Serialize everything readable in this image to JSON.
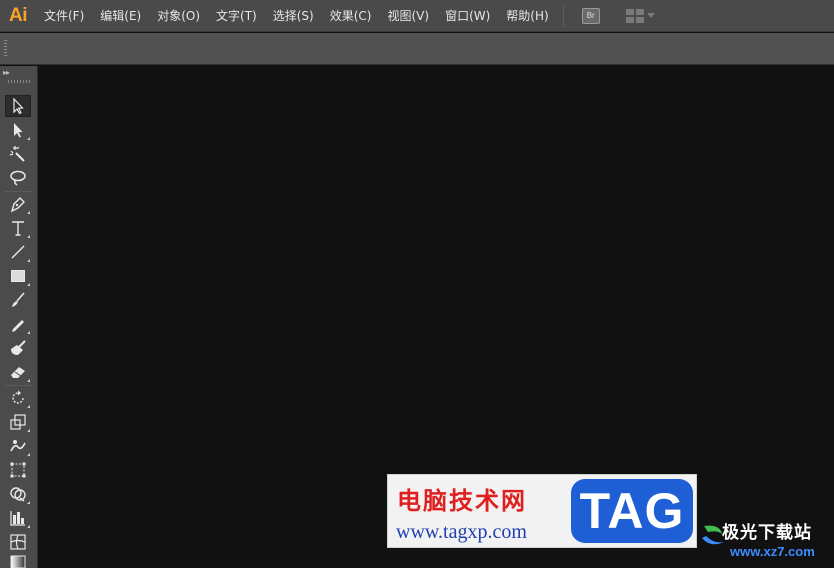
{
  "app": {
    "logo_text": "Ai",
    "accent_color": "#f7a428"
  },
  "menu": [
    {
      "label": "文件(F)",
      "name": "menu-file"
    },
    {
      "label": "编辑(E)",
      "name": "menu-edit"
    },
    {
      "label": "对象(O)",
      "name": "menu-object"
    },
    {
      "label": "文字(T)",
      "name": "menu-type"
    },
    {
      "label": "选择(S)",
      "name": "menu-select"
    },
    {
      "label": "效果(C)",
      "name": "menu-effect"
    },
    {
      "label": "视图(V)",
      "name": "menu-view"
    },
    {
      "label": "窗口(W)",
      "name": "menu-window"
    },
    {
      "label": "帮助(H)",
      "name": "menu-help"
    }
  ],
  "menubar_buttons": {
    "bridge_label": "Br",
    "workspace_icon": "workspace-switcher-icon"
  },
  "tools": [
    {
      "name": "selection-tool",
      "icon": "arrow-icon",
      "active": true
    },
    {
      "name": "direct-selection-tool",
      "icon": "direct-arrow-icon"
    },
    {
      "name": "magic-wand-tool",
      "icon": "magic-wand-icon"
    },
    {
      "name": "lasso-tool",
      "icon": "lasso-icon"
    },
    {
      "name": "pen-tool",
      "icon": "pen-icon"
    },
    {
      "name": "type-tool",
      "icon": "type-icon",
      "label": "T"
    },
    {
      "name": "line-segment-tool",
      "icon": "line-icon"
    },
    {
      "name": "rectangle-tool",
      "icon": "rectangle-icon"
    },
    {
      "name": "paintbrush-tool",
      "icon": "brush-icon"
    },
    {
      "name": "pencil-tool",
      "icon": "pencil-icon"
    },
    {
      "name": "blob-brush-tool",
      "icon": "blob-brush-icon"
    },
    {
      "name": "eraser-tool",
      "icon": "eraser-icon"
    },
    {
      "name": "rotate-tool",
      "icon": "rotate-icon"
    },
    {
      "name": "scale-tool",
      "icon": "scale-icon"
    },
    {
      "name": "warp-tool",
      "icon": "warp-icon"
    },
    {
      "name": "free-transform-tool",
      "icon": "free-transform-icon"
    },
    {
      "name": "shape-builder-tool",
      "icon": "shape-builder-icon"
    },
    {
      "name": "graph-tool",
      "icon": "graph-icon"
    },
    {
      "name": "mesh-tool",
      "icon": "mesh-icon"
    },
    {
      "name": "gradient-tool",
      "icon": "gradient-icon"
    }
  ],
  "watermark": {
    "site_name": "电脑技术网",
    "url": "www.tagxp.com",
    "tag": "TAG",
    "site2_name": "极光下载站",
    "site2_url": "www.xz7.com"
  }
}
